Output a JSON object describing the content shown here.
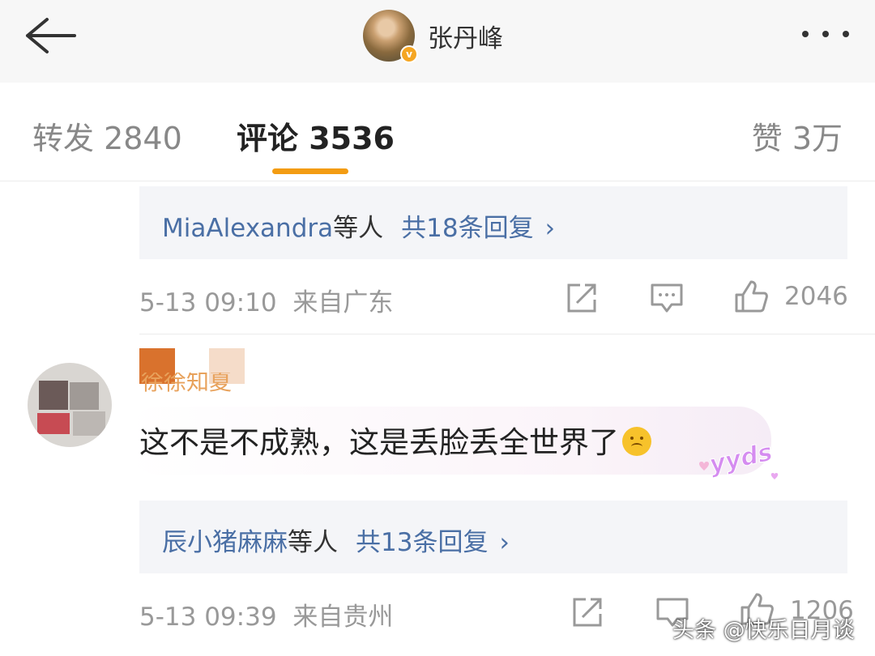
{
  "header": {
    "author_name": "张丹峰",
    "verified_badge": "v"
  },
  "tabs": {
    "repost": "转发 2840",
    "comments": "评论 3536",
    "likes": "赞 3万"
  },
  "comments": [
    {
      "reply_names": "MiaAlexandra",
      "reply_suffix": "等人",
      "reply_count": "共18条回复",
      "reply_chevron": "›",
      "time": "5-13 09:10",
      "location": "来自广东",
      "likes": "2046"
    },
    {
      "user_name": "徐徐知夏",
      "text": "这不是不成熟，这是丢脸丢全世界了",
      "sticker_text": "yyds",
      "reply_names": "辰小猪麻麻",
      "reply_suffix": "等人",
      "reply_count": "共13条回复",
      "reply_chevron": "›",
      "time": "5-13 09:39",
      "location": "来自贵州",
      "likes": "1206"
    }
  ],
  "watermark": "头条 @快乐日月谈",
  "colors": {
    "accent": "#f39c12",
    "link": "#4a6fa5",
    "verified": "#f5a623"
  }
}
